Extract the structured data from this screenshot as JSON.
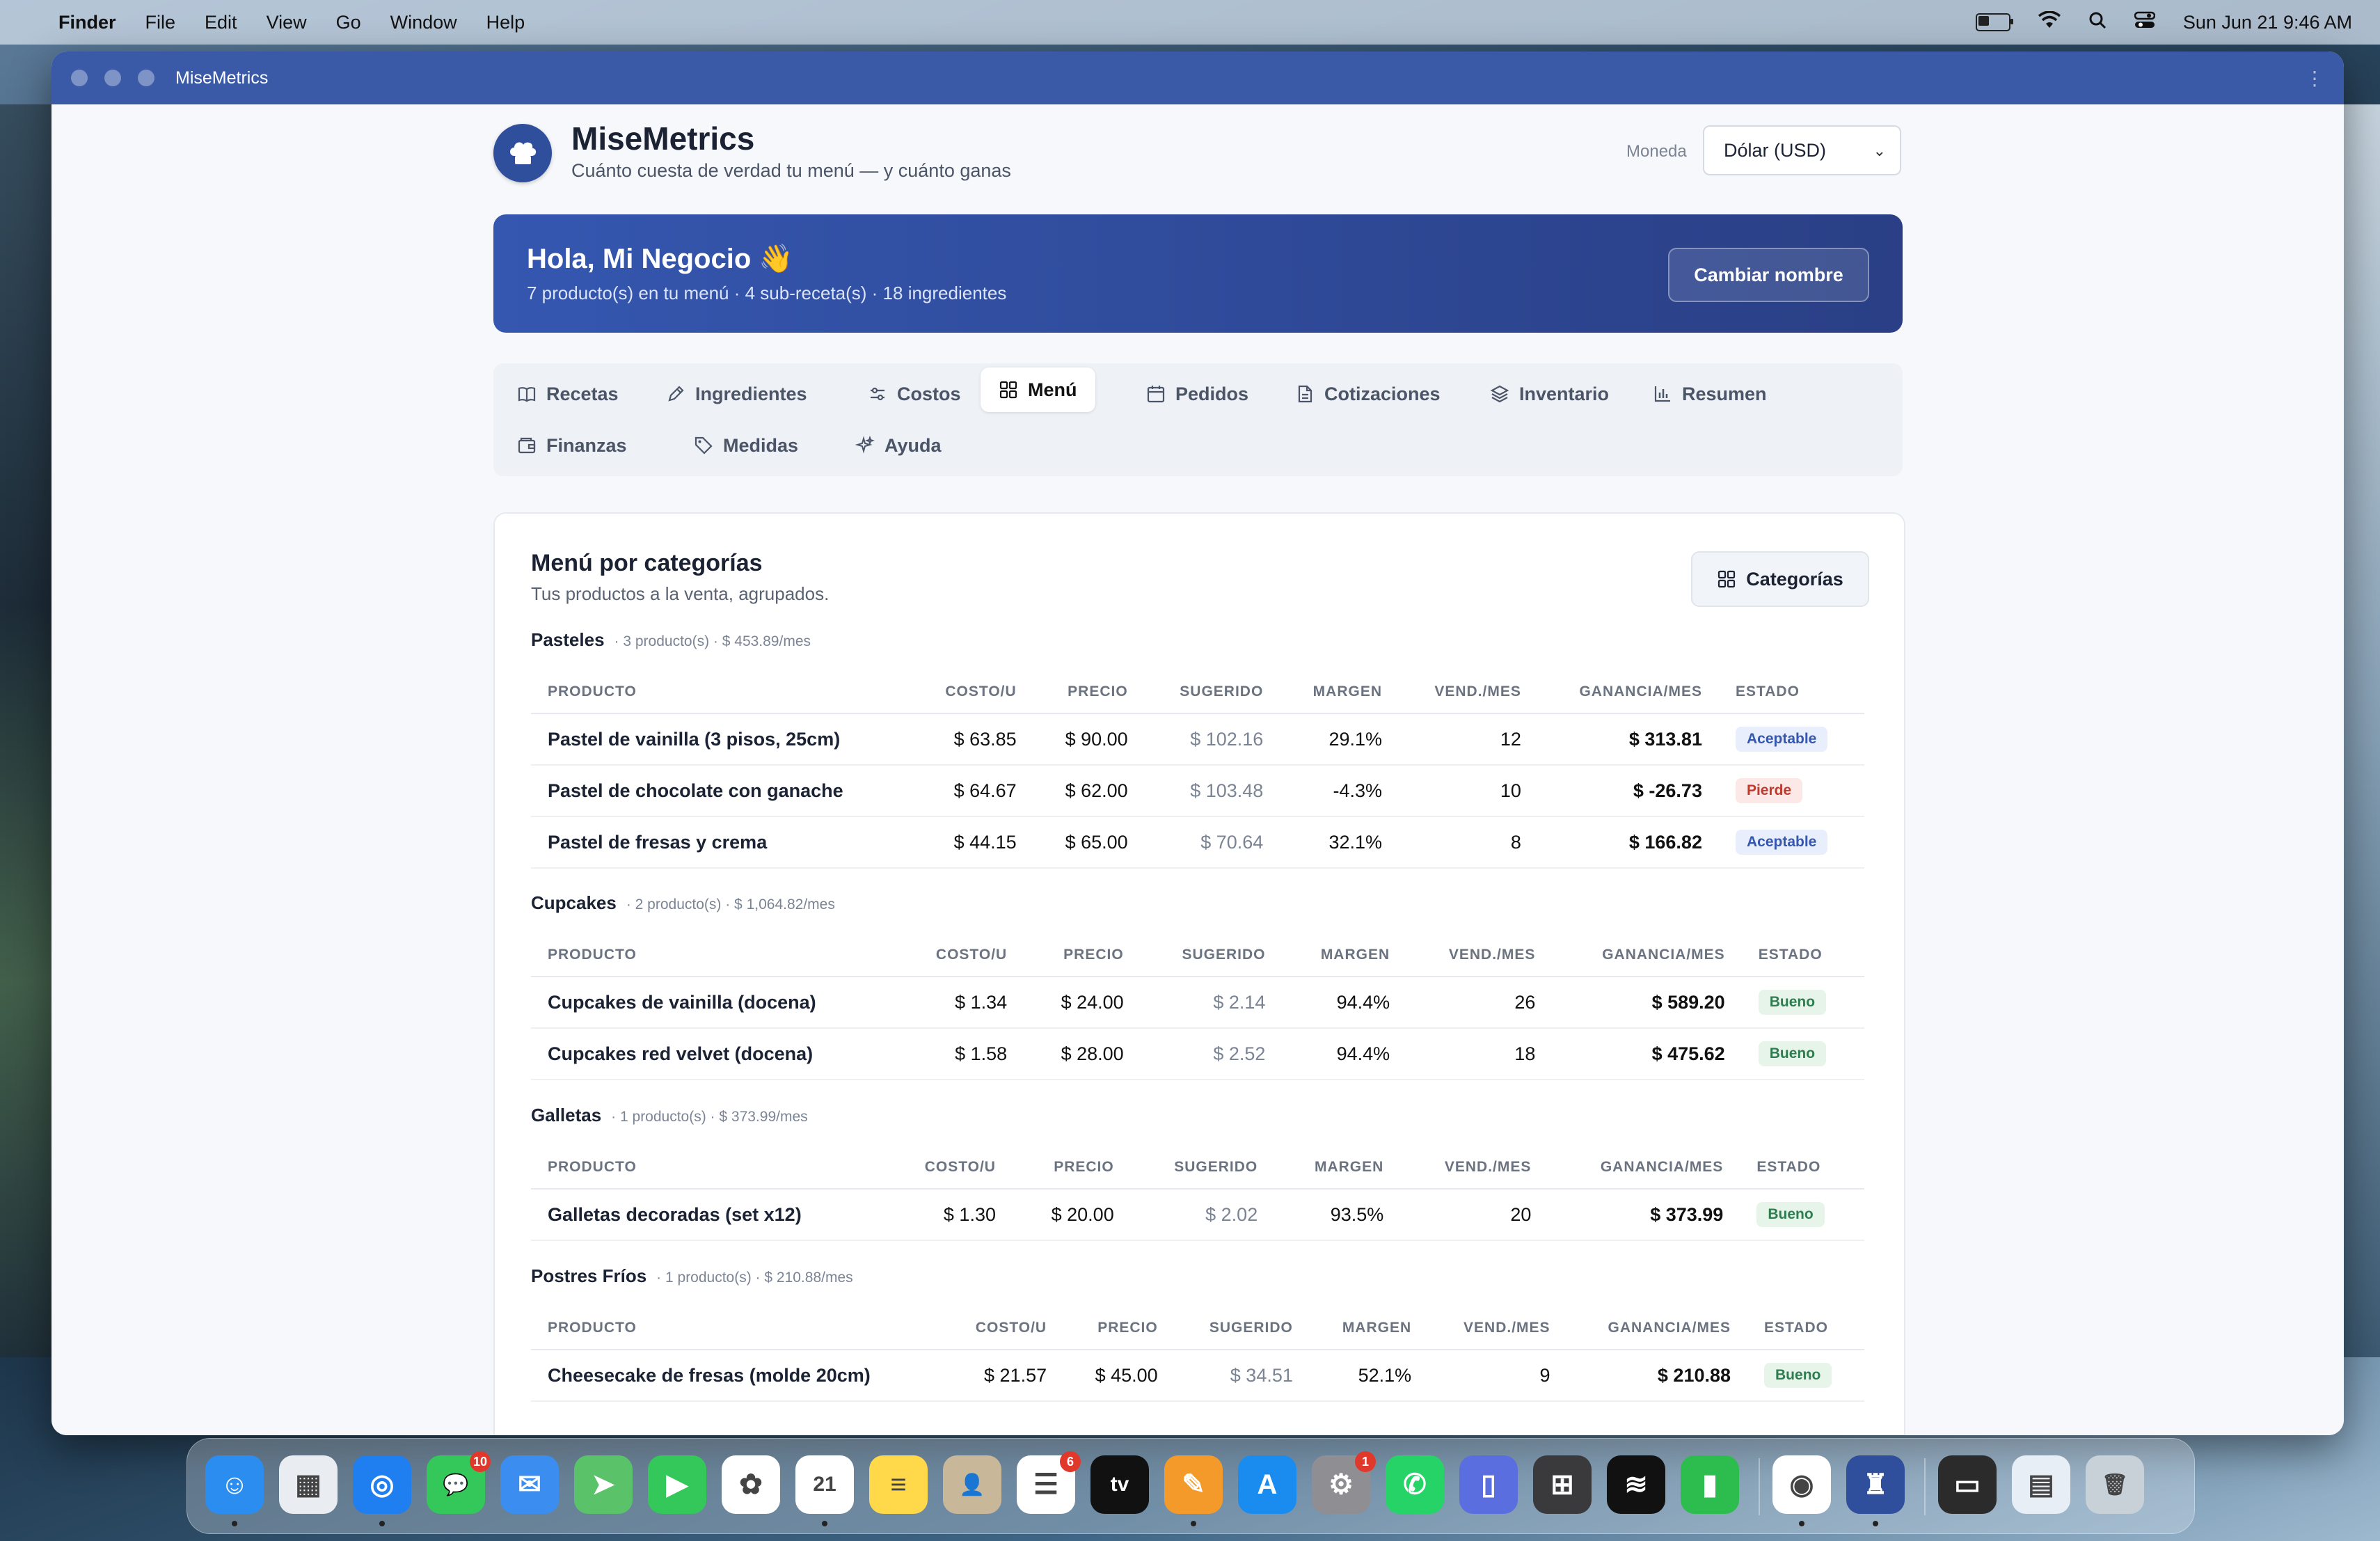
{
  "menubar": {
    "items": [
      "Finder",
      "File",
      "Edit",
      "View",
      "Go",
      "Window",
      "Help"
    ],
    "datetime": "Sun Jun 21  9:46 AM",
    "battery_level": 0.35
  },
  "window": {
    "title": "MiseMetrics"
  },
  "header": {
    "title": "MiseMetrics",
    "subtitle": "Cuánto cuesta de verdad tu menú — y cuánto ganas",
    "currency_label": "Moneda",
    "currency_value": "Dólar (USD)"
  },
  "banner": {
    "greeting": "Hola, Mi Negocio 👋",
    "stats": "7 producto(s) en tu menú · 4 sub-receta(s) · 18 ingredientes",
    "rename_button": "Cambiar nombre"
  },
  "tabs": [
    {
      "label": "Recetas",
      "icon": "book-icon"
    },
    {
      "label": "Ingredientes",
      "icon": "pen-icon"
    },
    {
      "label": "Costos",
      "icon": "sliders-icon"
    },
    {
      "label": "Menú",
      "icon": "grid-icon",
      "active": true
    },
    {
      "label": "Pedidos",
      "icon": "calendar-icon"
    },
    {
      "label": "Cotizaciones",
      "icon": "document-icon"
    },
    {
      "label": "Inventario",
      "icon": "layers-icon"
    },
    {
      "label": "Resumen",
      "icon": "bar-chart-icon"
    },
    {
      "label": "Finanzas",
      "icon": "wallet-icon"
    },
    {
      "label": "Medidas",
      "icon": "tag-icon"
    },
    {
      "label": "Ayuda",
      "icon": "sparkles-icon"
    }
  ],
  "menu": {
    "title": "Menú por categorías",
    "subtitle": "Tus productos a la venta, agrupados.",
    "categories_button": "Categorías",
    "columns": [
      "PRODUCTO",
      "COSTO/U",
      "PRECIO",
      "SUGERIDO",
      "MARGEN",
      "VEND./MES",
      "GANANCIA/MES",
      "ESTADO"
    ],
    "groups": [
      {
        "name": "Pasteles",
        "meta": "· 3 producto(s) · $ 453.89/mes",
        "rows": [
          {
            "product": "Pastel de vainilla (3 pisos, 25cm)",
            "cost": "$ 63.85",
            "price": "$ 90.00",
            "suggested": "$ 102.16",
            "margin": "29.1%",
            "sold": "12",
            "profit": "$ 313.81",
            "status": "Aceptable",
            "status_type": "ok"
          },
          {
            "product": "Pastel de chocolate con ganache",
            "cost": "$ 64.67",
            "price": "$ 62.00",
            "suggested": "$ 103.48",
            "margin": "-4.3%",
            "sold": "10",
            "profit": "$ -26.73",
            "status": "Pierde",
            "status_type": "bad"
          },
          {
            "product": "Pastel de fresas y crema",
            "cost": "$ 44.15",
            "price": "$ 65.00",
            "suggested": "$ 70.64",
            "margin": "32.1%",
            "sold": "8",
            "profit": "$ 166.82",
            "status": "Aceptable",
            "status_type": "ok"
          }
        ]
      },
      {
        "name": "Cupcakes",
        "meta": "· 2 producto(s) · $ 1,064.82/mes",
        "rows": [
          {
            "product": "Cupcakes de vainilla (docena)",
            "cost": "$ 1.34",
            "price": "$ 24.00",
            "suggested": "$ 2.14",
            "margin": "94.4%",
            "sold": "26",
            "profit": "$ 589.20",
            "status": "Bueno",
            "status_type": "good"
          },
          {
            "product": "Cupcakes red velvet (docena)",
            "cost": "$ 1.58",
            "price": "$ 28.00",
            "suggested": "$ 2.52",
            "margin": "94.4%",
            "sold": "18",
            "profit": "$ 475.62",
            "status": "Bueno",
            "status_type": "good"
          }
        ]
      },
      {
        "name": "Galletas",
        "meta": "· 1 producto(s) · $ 373.99/mes",
        "rows": [
          {
            "product": "Galletas decoradas (set x12)",
            "cost": "$ 1.30",
            "price": "$ 20.00",
            "suggested": "$ 2.02",
            "margin": "93.5%",
            "sold": "20",
            "profit": "$ 373.99",
            "status": "Bueno",
            "status_type": "good"
          }
        ]
      },
      {
        "name": "Postres Fríos",
        "meta": "· 1 producto(s) · $ 210.88/mes",
        "rows": [
          {
            "product": "Cheesecake de fresas (molde 20cm)",
            "cost": "$ 21.57",
            "price": "$ 45.00",
            "suggested": "$ 34.51",
            "margin": "52.1%",
            "sold": "9",
            "profit": "$ 210.88",
            "status": "Bueno",
            "status_type": "good"
          }
        ]
      }
    ]
  },
  "dock": {
    "apps": [
      {
        "name": "Finder",
        "icon": "finder-icon",
        "color": "#2b8df0",
        "glyph": "☺",
        "running": true
      },
      {
        "name": "Launchpad",
        "icon": "launchpad-icon",
        "color": "#e9edf2",
        "glyph": "▦"
      },
      {
        "name": "Safari",
        "icon": "safari-icon",
        "color": "#1f7ff0",
        "glyph": "◎",
        "running": true
      },
      {
        "name": "Messages",
        "icon": "messages-icon",
        "color": "#34c759",
        "glyph": "💬",
        "badge": "10"
      },
      {
        "name": "Mail",
        "icon": "mail-icon",
        "color": "#3b8ef0",
        "glyph": "✉"
      },
      {
        "name": "Maps",
        "icon": "maps-icon",
        "color": "#5ac36a",
        "glyph": "➤"
      },
      {
        "name": "FaceTime",
        "icon": "facetime-icon",
        "color": "#34c759",
        "glyph": "▶"
      },
      {
        "name": "Photos",
        "icon": "photos-icon",
        "color": "#ffffff",
        "glyph": "✿"
      },
      {
        "name": "Calendar",
        "icon": "calendar-app-icon",
        "color": "#ffffff",
        "glyph": "21",
        "running": true
      },
      {
        "name": "Notes",
        "icon": "notes-icon",
        "color": "#ffd94a",
        "glyph": "≡"
      },
      {
        "name": "Contacts",
        "icon": "contacts-icon",
        "color": "#c9b79a",
        "glyph": "👤"
      },
      {
        "name": "Reminders",
        "icon": "reminders-icon",
        "color": "#ffffff",
        "glyph": "☰",
        "badge": "6"
      },
      {
        "name": "TV",
        "icon": "tv-icon",
        "color": "#111111",
        "glyph": "tv"
      },
      {
        "name": "Pages",
        "icon": "pages-icon",
        "color": "#f39a2b",
        "glyph": "✎",
        "running": true
      },
      {
        "name": "App Store",
        "icon": "app-store-icon",
        "color": "#1a8cf0",
        "glyph": "A"
      },
      {
        "name": "System Settings",
        "icon": "settings-icon",
        "color": "#8e8e93",
        "glyph": "⚙",
        "badge": "1"
      },
      {
        "name": "WhatsApp",
        "icon": "whatsapp-icon",
        "color": "#25d366",
        "glyph": "✆"
      },
      {
        "name": "Simulator",
        "icon": "simulator-icon",
        "color": "#5b6ee0",
        "glyph": "▯"
      },
      {
        "name": "Calculator",
        "icon": "calculator-icon",
        "color": "#3a3a3c",
        "glyph": "⊞"
      },
      {
        "name": "Spotify",
        "icon": "spotify-icon",
        "color": "#111111",
        "glyph": "≋"
      },
      {
        "name": "Numbers",
        "icon": "numbers-icon",
        "color": "#2dbd4e",
        "glyph": "▮"
      },
      {
        "name": "Chrome",
        "icon": "chrome-icon",
        "color": "#ffffff",
        "glyph": "◉",
        "running": true
      },
      {
        "name": "MiseMetrics",
        "icon": "misemetrics-icon",
        "color": "#2f4f9c",
        "glyph": "♜",
        "running": true
      },
      {
        "name": "Wallet",
        "icon": "wallet-app-icon",
        "color": "#2b2b2b",
        "glyph": "▭"
      },
      {
        "name": "Preview",
        "icon": "preview-icon",
        "color": "#e8eef6",
        "glyph": "▤"
      },
      {
        "name": "Trash",
        "icon": "trash-icon",
        "color": "#c8d0d8",
        "glyph": "🗑"
      }
    ]
  }
}
